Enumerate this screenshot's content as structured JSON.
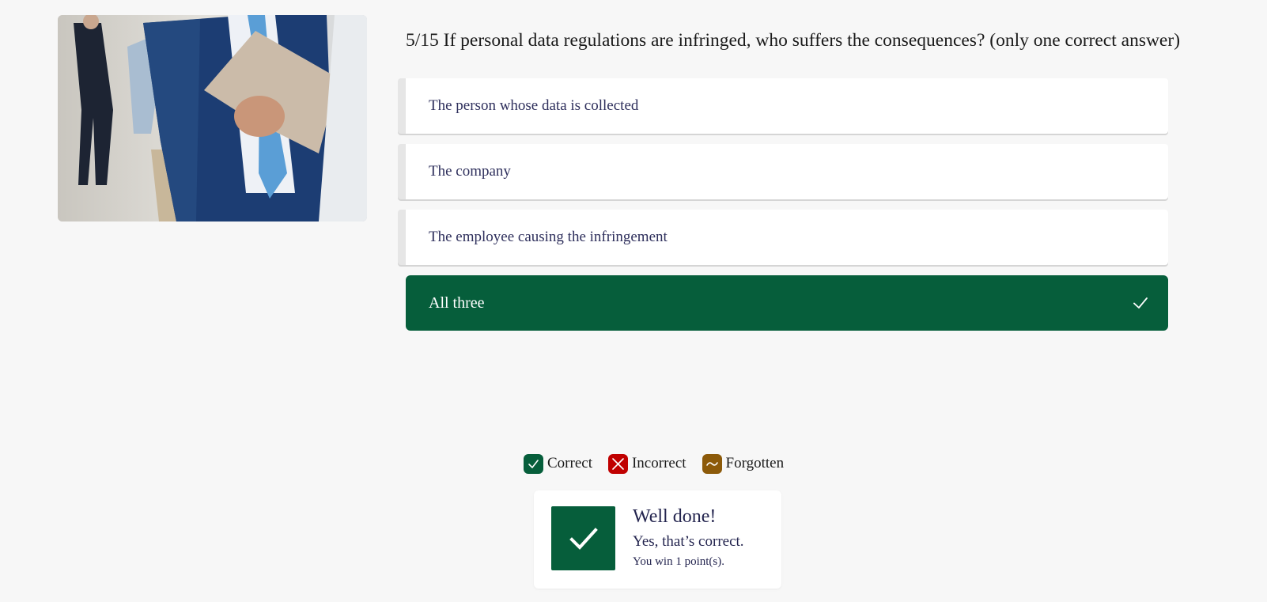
{
  "question": {
    "text": "5/15 If personal data regulations are infringed, who suffers the consequences? (only one correct answer)"
  },
  "answers": [
    {
      "label": "The person whose data is collected"
    },
    {
      "label": "The company"
    },
    {
      "label": "The employee causing the infringement"
    },
    {
      "label": "All three"
    }
  ],
  "legend": {
    "correct": "Correct",
    "incorrect": "Incorrect",
    "forgotten": "Forgotten"
  },
  "feedback": {
    "title": "Well done!",
    "message": "Yes, that’s correct.",
    "points": "You win 1 point(s)."
  },
  "colors": {
    "correct": "#065e3b",
    "incorrect": "#c00000",
    "forgotten": "#8c5a0a",
    "answer_text": "#2e2f5c",
    "background": "#f7f7f7"
  },
  "icons": {
    "selected_answer": "checkmark-icon",
    "legend_correct": "checkmark-icon",
    "legend_incorrect": "cross-icon",
    "legend_forgotten": "tilde-icon",
    "feedback": "checkmark-icon"
  }
}
